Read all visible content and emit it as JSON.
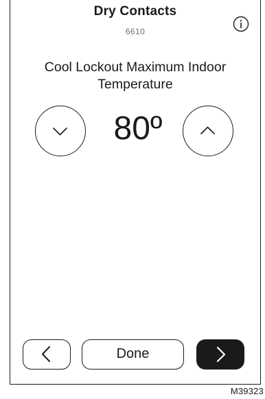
{
  "header": {
    "title": "Dry Contacts",
    "code": "6610",
    "info_icon": "info-icon"
  },
  "setting": {
    "label": "Cool Lockout Maximum Indoor Temperature",
    "value": "80º",
    "decrease_icon": "chevron-down-icon",
    "increase_icon": "chevron-up-icon"
  },
  "footer": {
    "back_icon": "chevron-left-icon",
    "done_label": "Done",
    "next_icon": "chevron-right-icon"
  },
  "figure_code": "M39323",
  "colors": {
    "foreground": "#1a1a1a",
    "background": "#ffffff",
    "subtle_text": "#6e6e6e"
  }
}
